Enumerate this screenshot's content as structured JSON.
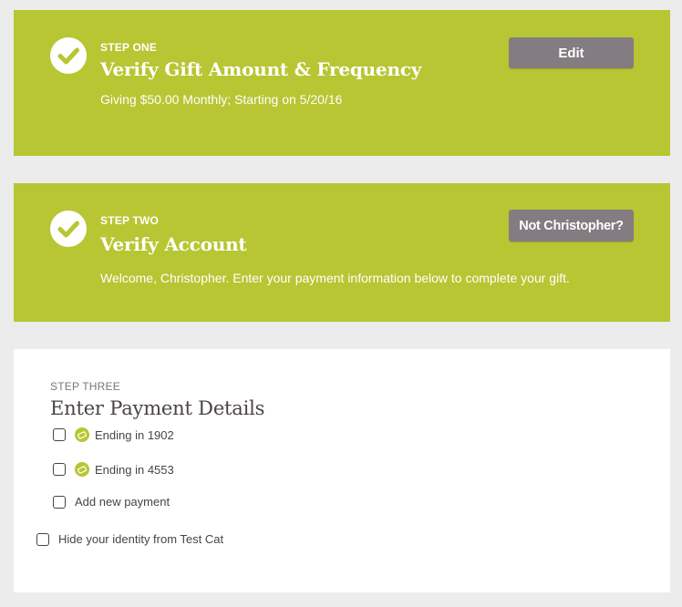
{
  "step1": {
    "label": "STEP ONE",
    "title": "Verify Gift Amount & Frequency",
    "description": "Giving $50.00 Monthly; Starting on 5/20/16",
    "button": "Edit"
  },
  "step2": {
    "label": "STEP TWO",
    "title": "Verify Account",
    "description": "Welcome, Christopher. Enter your payment information below to complete your gift.",
    "button": "Not Christopher?"
  },
  "step3": {
    "label": "STEP THREE",
    "title": "Enter Payment Details",
    "options": [
      {
        "label": "Ending in 1902",
        "icon": "card-icon",
        "checked": false
      },
      {
        "label": "Ending in 4553",
        "icon": "card-icon",
        "checked": false
      },
      {
        "label": "Add new payment",
        "checked": false
      }
    ],
    "hide_identity": {
      "label": "Hide your identity from Test Cat",
      "checked": false
    }
  },
  "colors": {
    "accent": "#b7c632",
    "button": "#837c80",
    "background": "#ececec",
    "text_dark": "#4a4346"
  }
}
